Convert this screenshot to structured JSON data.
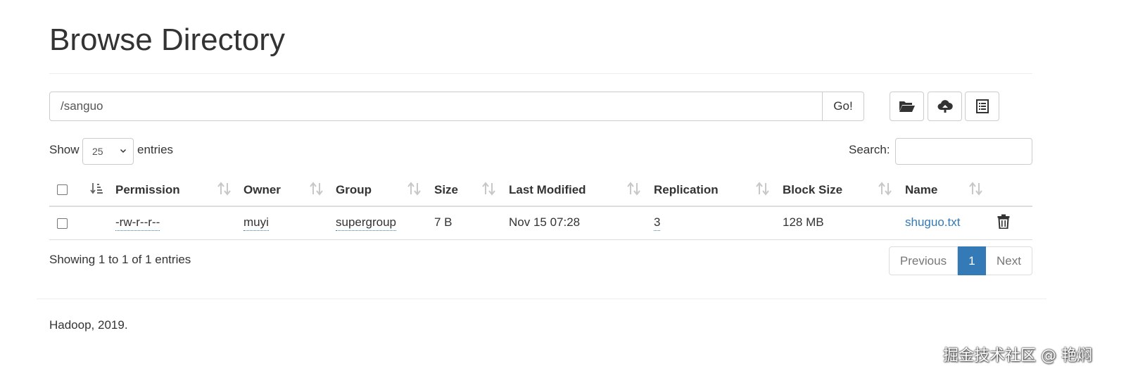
{
  "page": {
    "title": "Browse Directory"
  },
  "path_bar": {
    "value": "/sanguo",
    "go_label": "Go!"
  },
  "toolbar": {
    "icons": [
      "folder-open-icon",
      "cloud-upload-icon",
      "list-icon"
    ]
  },
  "table_controls": {
    "show_label": "Show",
    "page_length": "25",
    "entries_label": "entries",
    "search_label": "Search:",
    "search_value": ""
  },
  "table": {
    "columns": [
      "Permission",
      "Owner",
      "Group",
      "Size",
      "Last Modified",
      "Replication",
      "Block Size",
      "Name"
    ],
    "rows": [
      {
        "permission": "-rw-r--r--",
        "owner": "muyi",
        "group": "supergroup",
        "size": "7 B",
        "last_modified": "Nov 15 07:28",
        "replication": "3",
        "block_size": "128 MB",
        "name": "shuguo.txt"
      }
    ]
  },
  "summary": {
    "info": "Showing 1 to 1 of 1 entries"
  },
  "pagination": {
    "previous": "Previous",
    "current": "1",
    "next": "Next"
  },
  "footer": {
    "text": "Hadoop, 2019."
  },
  "watermark": {
    "text": "掘金技术社区 @ 艳焖"
  },
  "colors": {
    "link": "#337ab7",
    "active_page": "#337ab7",
    "border": "#cccccc"
  }
}
